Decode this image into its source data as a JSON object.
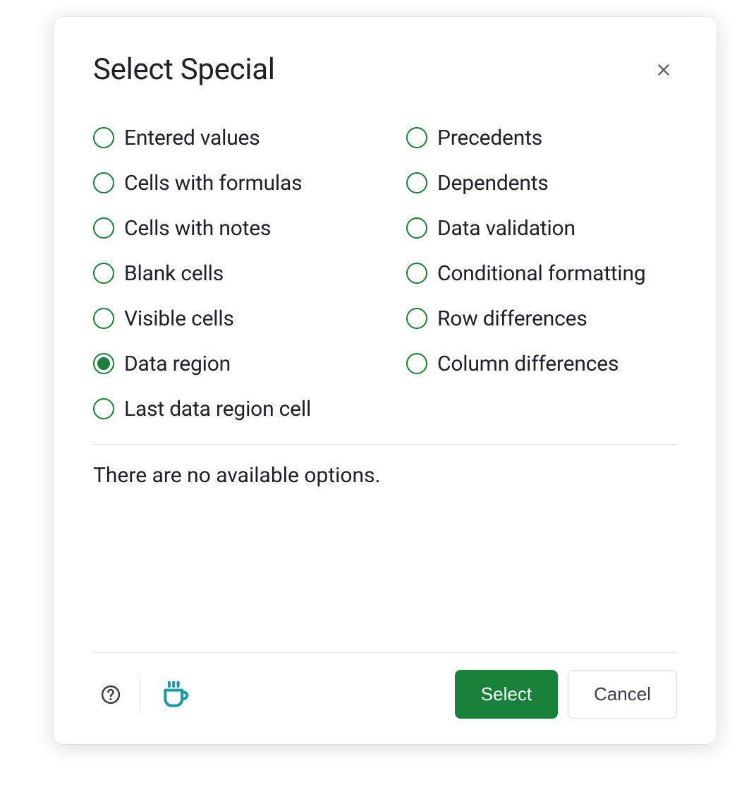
{
  "dialog": {
    "title": "Select Special",
    "options_left": [
      {
        "id": "entered-values",
        "label": "Entered values",
        "selected": false
      },
      {
        "id": "cells-with-formulas",
        "label": "Cells with formulas",
        "selected": false
      },
      {
        "id": "cells-with-notes",
        "label": "Cells with notes",
        "selected": false
      },
      {
        "id": "blank-cells",
        "label": "Blank cells",
        "selected": false
      },
      {
        "id": "visible-cells",
        "label": "Visible cells",
        "selected": false
      },
      {
        "id": "data-region",
        "label": "Data region",
        "selected": true
      },
      {
        "id": "last-data-region-cell",
        "label": "Last data region cell",
        "selected": false
      }
    ],
    "options_right": [
      {
        "id": "precedents",
        "label": "Precedents",
        "selected": false
      },
      {
        "id": "dependents",
        "label": "Dependents",
        "selected": false
      },
      {
        "id": "data-validation",
        "label": "Data validation",
        "selected": false
      },
      {
        "id": "conditional-formatting",
        "label": "Conditional formatting",
        "selected": false
      },
      {
        "id": "row-differences",
        "label": "Row differences",
        "selected": false
      },
      {
        "id": "column-differences",
        "label": "Column differences",
        "selected": false
      }
    ],
    "no_options_message": "There are no available options.",
    "buttons": {
      "select": "Select",
      "cancel": "Cancel"
    }
  }
}
